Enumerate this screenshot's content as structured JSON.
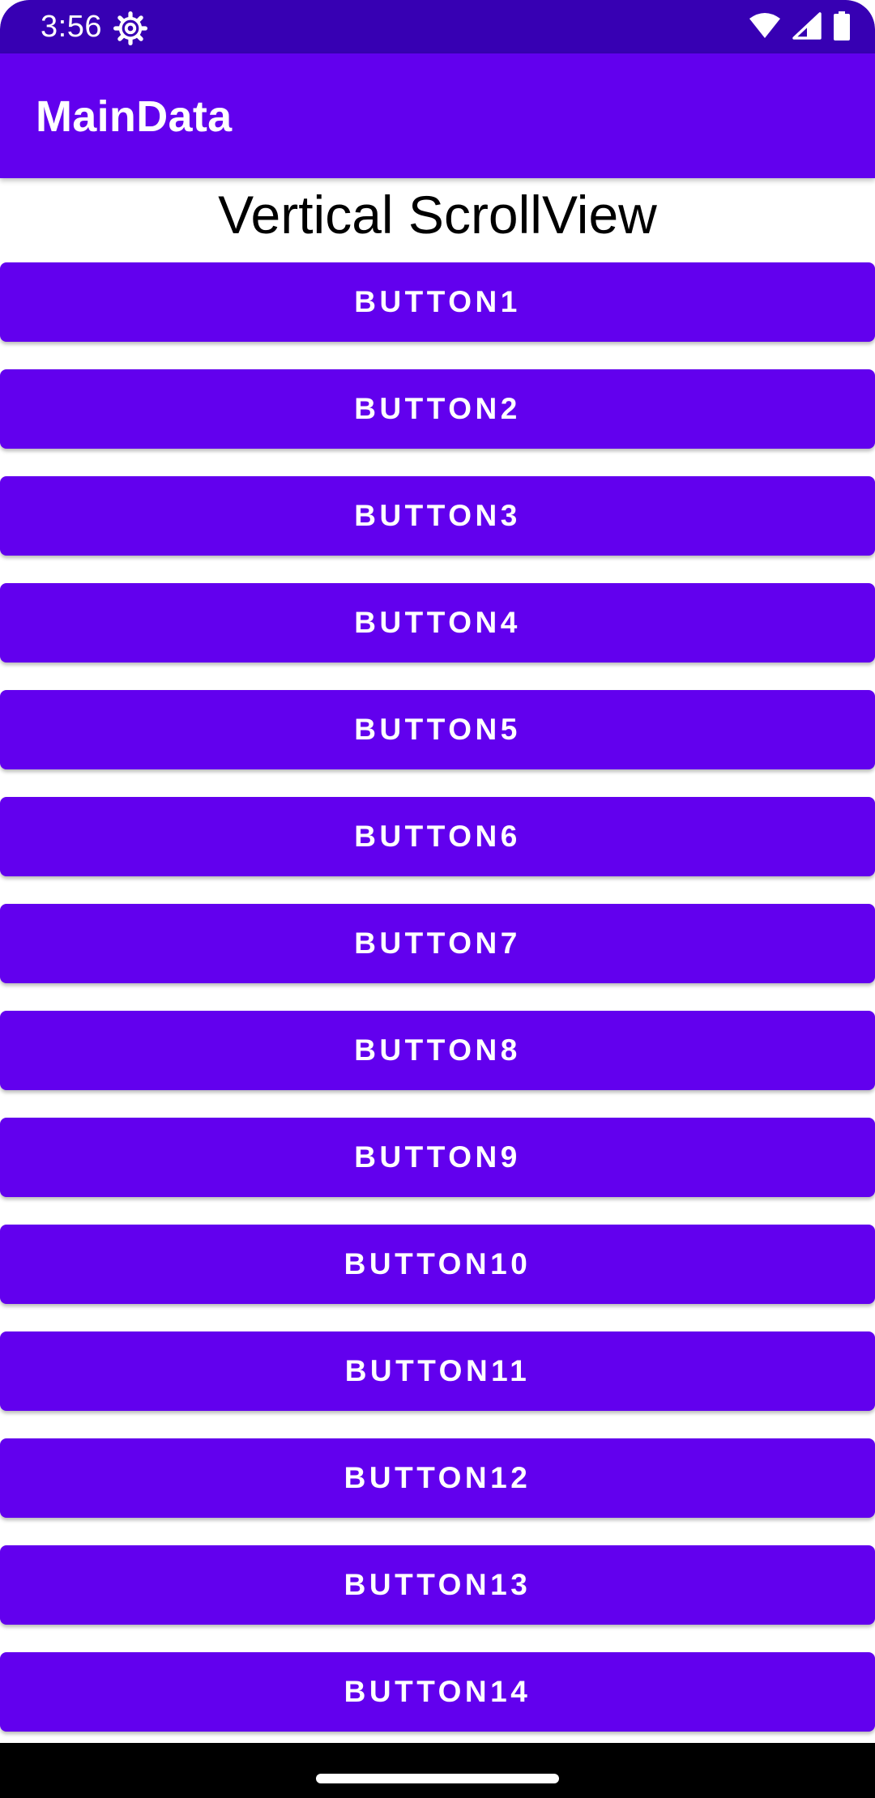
{
  "status_bar": {
    "time": "3:56",
    "icons": [
      "settings-gear-icon",
      "wifi-icon",
      "cell-signal-icon",
      "battery-icon"
    ]
  },
  "app_bar": {
    "title": "MainData"
  },
  "content": {
    "heading": "Vertical ScrollView",
    "buttons": [
      {
        "label": "BUTTON1"
      },
      {
        "label": "BUTTON2"
      },
      {
        "label": "BUTTON3"
      },
      {
        "label": "BUTTON4"
      },
      {
        "label": "BUTTON5"
      },
      {
        "label": "BUTTON6"
      },
      {
        "label": "BUTTON7"
      },
      {
        "label": "BUTTON8"
      },
      {
        "label": "BUTTON9"
      },
      {
        "label": "BUTTON10"
      },
      {
        "label": "BUTTON11"
      },
      {
        "label": "BUTTON12"
      },
      {
        "label": "BUTTON13"
      },
      {
        "label": "BUTTON14"
      }
    ]
  },
  "colors": {
    "status_bar": "#3700B3",
    "primary": "#6200EE",
    "button_text": "#FFFFFF",
    "background": "#FFFFFF",
    "nav_bar": "#000000"
  }
}
